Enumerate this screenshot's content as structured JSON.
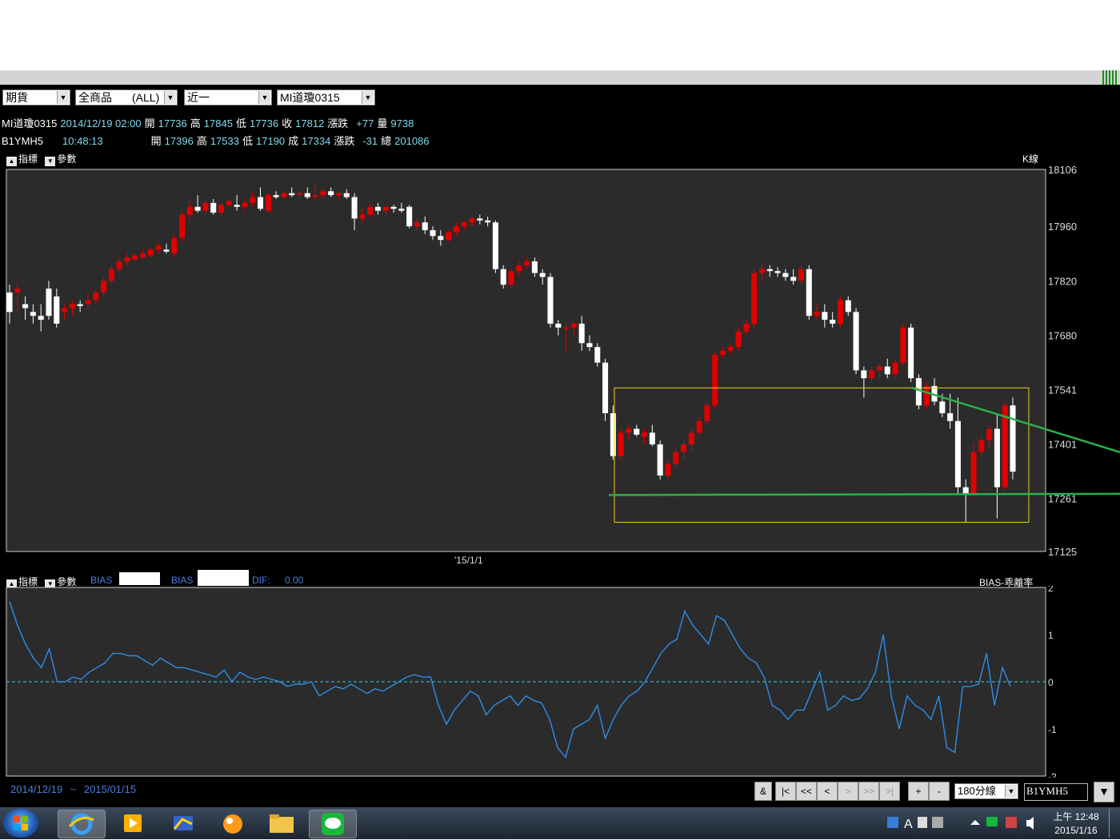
{
  "toolbar": {
    "market": "期貨",
    "product": "全商品",
    "product_filter": "(ALL)",
    "month": "近一",
    "symbol": "MI道瓊0315"
  },
  "quote1": {
    "name": "MI道瓊0315",
    "datetime": "2014/12/19 02:00",
    "open_label": "開",
    "open": "17736",
    "high_label": "高",
    "high": "17845",
    "low_label": "低",
    "low": "17736",
    "close_label": "收",
    "close": "17812",
    "chg_label": "漲跌",
    "chg": "+77",
    "vol_label": "量",
    "vol": "9738"
  },
  "quote2": {
    "name": "B1YMH5",
    "time": "10:48:13",
    "open_label": "開",
    "open": "17396",
    "high_label": "高",
    "high": "17533",
    "low_label": "低",
    "low": "17190",
    "last_label": "成",
    "last": "17334",
    "chg_label": "漲跌",
    "chg": "-31",
    "vol_label": "總",
    "vol": "201086"
  },
  "main_panel": {
    "indicator_btn": "指標",
    "param_btn": "參數",
    "type_label": "K線",
    "date_tick": "'15/1/1"
  },
  "sub_panel": {
    "indicator_btn": "指標",
    "param_btn": "參數",
    "bias1_label": "BIAS",
    "bias2_label": "BIAS",
    "dif_label": "DIF:",
    "dif_value": "0.00",
    "type_label": "BIAS-乖離率"
  },
  "range": {
    "start": "2014/12/19",
    "sep": "~",
    "end": "2015/01/15"
  },
  "nav": {
    "amp": "&",
    "first": "|<",
    "prev_page": "<<",
    "prev": "<",
    "next": ">",
    "next_page": ">>",
    "last": ">|",
    "zoom_in": "+",
    "zoom_out": "-",
    "interval": "180分線",
    "symbol_input": "B1YMH5"
  },
  "clock": {
    "time": "上午 12:48",
    "date": "2015/1/16"
  },
  "colors": {
    "up": "#e00000",
    "down": "#ffffff",
    "bias_line": "#2f8de8",
    "zero_line": "#3fc8e0",
    "trend_line": "#2ab04a",
    "box": "#e5d21a",
    "panel_bg": "#2b2b2b"
  },
  "chart_data": [
    {
      "type": "candlestick",
      "y_ticks": [
        18106,
        17960,
        17820,
        17680,
        17541,
        17401,
        17261,
        17125
      ],
      "ylim": [
        17125,
        18106
      ],
      "x_tick_label": "'15/1/1",
      "ohlc": [
        [
          17790,
          17810,
          17710,
          17740
        ],
        [
          17790,
          17815,
          17740,
          17800
        ],
        [
          17760,
          17780,
          17720,
          17750
        ],
        [
          17740,
          17760,
          17710,
          17730
        ],
        [
          17730,
          17760,
          17690,
          17720
        ],
        [
          17800,
          17820,
          17720,
          17730
        ],
        [
          17780,
          17800,
          17700,
          17710
        ],
        [
          17740,
          17760,
          17720,
          17750
        ],
        [
          17750,
          17770,
          17730,
          17760
        ],
        [
          17760,
          17770,
          17740,
          17755
        ],
        [
          17760,
          17790,
          17750,
          17770
        ],
        [
          17770,
          17800,
          17760,
          17790
        ],
        [
          17790,
          17830,
          17780,
          17820
        ],
        [
          17820,
          17860,
          17810,
          17850
        ],
        [
          17850,
          17880,
          17840,
          17870
        ],
        [
          17870,
          17890,
          17860,
          17880
        ],
        [
          17875,
          17890,
          17870,
          17885
        ],
        [
          17880,
          17900,
          17875,
          17890
        ],
        [
          17885,
          17905,
          17880,
          17900
        ],
        [
          17900,
          17920,
          17890,
          17910
        ],
        [
          17900,
          17915,
          17890,
          17895
        ],
        [
          17890,
          17940,
          17880,
          17930
        ],
        [
          17930,
          18000,
          17920,
          17990
        ],
        [
          17990,
          18030,
          17980,
          18010
        ],
        [
          18010,
          18040,
          17995,
          18000
        ],
        [
          18000,
          18030,
          17995,
          18020
        ],
        [
          18020,
          18030,
          17990,
          17995
        ],
        [
          17995,
          18020,
          17985,
          18015
        ],
        [
          18015,
          18030,
          18005,
          18025
        ],
        [
          18015,
          18040,
          18000,
          18010
        ],
        [
          18010,
          18030,
          18000,
          18020
        ],
        [
          18020,
          18050,
          18010,
          18035
        ],
        [
          18035,
          18060,
          18000,
          18005
        ],
        [
          18000,
          18045,
          17995,
          18040
        ],
        [
          18040,
          18050,
          18030,
          18035
        ],
        [
          18035,
          18050,
          18030,
          18045
        ],
        [
          18045,
          18060,
          18035,
          18040
        ],
        [
          18040,
          18050,
          18030,
          18045
        ],
        [
          18045,
          18060,
          18030,
          18035
        ],
        [
          18035,
          18070,
          18030,
          18040
        ],
        [
          18040,
          18055,
          18030,
          18050
        ],
        [
          18050,
          18060,
          18035,
          18040
        ],
        [
          18040,
          18050,
          18030,
          18045
        ],
        [
          18045,
          18055,
          18030,
          18035
        ],
        [
          18035,
          18045,
          17950,
          17980
        ],
        [
          17980,
          18010,
          17970,
          17990
        ],
        [
          17990,
          18020,
          17980,
          18010
        ],
        [
          18010,
          18020,
          17990,
          18000
        ],
        [
          18000,
          18015,
          17990,
          18010
        ],
        [
          18010,
          18015,
          17995,
          18005
        ],
        [
          18005,
          18020,
          17995,
          18000
        ],
        [
          18010,
          18015,
          17955,
          17960
        ],
        [
          17960,
          17980,
          17950,
          17970
        ],
        [
          17970,
          17985,
          17940,
          17950
        ],
        [
          17950,
          17960,
          17925,
          17935
        ],
        [
          17935,
          17950,
          17910,
          17925
        ],
        [
          17925,
          17950,
          17920,
          17945
        ],
        [
          17945,
          17970,
          17935,
          17960
        ],
        [
          17960,
          17975,
          17950,
          17970
        ],
        [
          17970,
          17985,
          17960,
          17980
        ],
        [
          17980,
          17990,
          17965,
          17975
        ],
        [
          17975,
          17985,
          17960,
          17970
        ],
        [
          17970,
          17975,
          17840,
          17850
        ],
        [
          17850,
          17860,
          17800,
          17810
        ],
        [
          17810,
          17850,
          17800,
          17845
        ],
        [
          17845,
          17870,
          17830,
          17860
        ],
        [
          17860,
          17880,
          17850,
          17870
        ],
        [
          17870,
          17880,
          17830,
          17840
        ],
        [
          17840,
          17850,
          17810,
          17830
        ],
        [
          17830,
          17840,
          17700,
          17710
        ],
        [
          17710,
          17720,
          17680,
          17700
        ],
        [
          17700,
          17710,
          17640,
          17700
        ],
        [
          17700,
          17715,
          17680,
          17710
        ],
        [
          17710,
          17730,
          17640,
          17660
        ],
        [
          17660,
          17680,
          17640,
          17650
        ],
        [
          17650,
          17660,
          17600,
          17610
        ],
        [
          17610,
          17620,
          17460,
          17480
        ],
        [
          17480,
          17500,
          17360,
          17370
        ],
        [
          17370,
          17440,
          17360,
          17430
        ],
        [
          17430,
          17450,
          17410,
          17440
        ],
        [
          17440,
          17450,
          17420,
          17425
        ],
        [
          17420,
          17440,
          17400,
          17430
        ],
        [
          17430,
          17450,
          17395,
          17400
        ],
        [
          17400,
          17410,
          17310,
          17320
        ],
        [
          17320,
          17360,
          17310,
          17350
        ],
        [
          17350,
          17390,
          17340,
          17380
        ],
        [
          17380,
          17410,
          17360,
          17400
        ],
        [
          17400,
          17440,
          17380,
          17430
        ],
        [
          17430,
          17470,
          17420,
          17460
        ],
        [
          17460,
          17510,
          17450,
          17500
        ],
        [
          17500,
          17640,
          17490,
          17630
        ],
        [
          17630,
          17650,
          17620,
          17640
        ],
        [
          17640,
          17660,
          17630,
          17650
        ],
        [
          17650,
          17700,
          17640,
          17690
        ],
        [
          17690,
          17720,
          17680,
          17710
        ],
        [
          17710,
          17850,
          17700,
          17840
        ],
        [
          17840,
          17860,
          17820,
          17850
        ],
        [
          17850,
          17860,
          17830,
          17845
        ],
        [
          17845,
          17855,
          17830,
          17840
        ],
        [
          17840,
          17850,
          17820,
          17830
        ],
        [
          17830,
          17850,
          17810,
          17820
        ],
        [
          17820,
          17860,
          17810,
          17850
        ],
        [
          17850,
          17860,
          17720,
          17730
        ],
        [
          17730,
          17760,
          17720,
          17740
        ],
        [
          17740,
          17760,
          17700,
          17720
        ],
        [
          17720,
          17740,
          17700,
          17710
        ],
        [
          17710,
          17780,
          17700,
          17770
        ],
        [
          17770,
          17780,
          17730,
          17740
        ],
        [
          17740,
          17750,
          17580,
          17590
        ],
        [
          17590,
          17600,
          17520,
          17570
        ],
        [
          17570,
          17600,
          17560,
          17590
        ],
        [
          17590,
          17610,
          17570,
          17600
        ],
        [
          17600,
          17620,
          17570,
          17580
        ],
        [
          17580,
          17620,
          17570,
          17610
        ],
        [
          17610,
          17710,
          17600,
          17700
        ],
        [
          17700,
          17710,
          17560,
          17570
        ],
        [
          17570,
          17580,
          17490,
          17500
        ],
        [
          17500,
          17560,
          17490,
          17550
        ],
        [
          17550,
          17570,
          17500,
          17510
        ],
        [
          17510,
          17530,
          17470,
          17480
        ],
        [
          17480,
          17530,
          17440,
          17460
        ],
        [
          17460,
          17520,
          17270,
          17290
        ],
        [
          17290,
          17310,
          17200,
          17270
        ],
        [
          17270,
          17400,
          17260,
          17380
        ],
        [
          17380,
          17420,
          17370,
          17410
        ],
        [
          17410,
          17450,
          17390,
          17440
        ],
        [
          17440,
          17480,
          17210,
          17290
        ],
        [
          17290,
          17510,
          17280,
          17500
        ],
        [
          17500,
          17520,
          17310,
          17330
        ]
      ],
      "annotations": [
        "yellow box",
        "green trend line",
        "green support line"
      ]
    },
    {
      "type": "line",
      "name": "BIAS",
      "y_ticks": [
        2,
        1,
        0,
        -1,
        -2
      ],
      "ylim": [
        -2,
        2
      ],
      "values": [
        1.7,
        1.2,
        0.8,
        0.5,
        0.3,
        0.7,
        0.0,
        0.0,
        0.1,
        0.05,
        0.2,
        0.3,
        0.4,
        0.6,
        0.6,
        0.55,
        0.55,
        0.45,
        0.35,
        0.5,
        0.4,
        0.3,
        0.3,
        0.25,
        0.2,
        0.15,
        0.1,
        0.25,
        0.0,
        0.2,
        0.1,
        0.05,
        0.1,
        0.05,
        0.0,
        -0.1,
        -0.05,
        -0.05,
        0.0,
        -0.3,
        -0.2,
        -0.1,
        -0.15,
        -0.05,
        -0.15,
        -0.25,
        -0.15,
        -0.2,
        -0.1,
        0.0,
        0.1,
        0.15,
        0.1,
        0.1,
        -0.5,
        -0.9,
        -0.6,
        -0.4,
        -0.2,
        -0.3,
        -0.7,
        -0.5,
        -0.4,
        -0.3,
        -0.5,
        -0.3,
        -0.4,
        -0.45,
        -0.8,
        -1.4,
        -1.6,
        -1.0,
        -0.9,
        -0.8,
        -0.5,
        -1.2,
        -0.8,
        -0.5,
        -0.3,
        -0.2,
        0.0,
        0.3,
        0.6,
        0.8,
        0.9,
        1.5,
        1.2,
        1.0,
        0.8,
        1.4,
        1.3,
        1.0,
        0.7,
        0.5,
        0.4,
        0.1,
        -0.5,
        -0.6,
        -0.8,
        -0.6,
        -0.6,
        -0.2,
        0.2,
        -0.6,
        -0.5,
        -0.3,
        -0.4,
        -0.35,
        -0.15,
        0.2,
        1.0,
        -0.3,
        -1.0,
        -0.3,
        -0.5,
        -0.6,
        -0.8,
        -0.3,
        -1.4,
        -1.5,
        -0.1,
        -0.1,
        -0.05,
        0.6,
        -0.5,
        0.3,
        -0.1
      ]
    }
  ]
}
